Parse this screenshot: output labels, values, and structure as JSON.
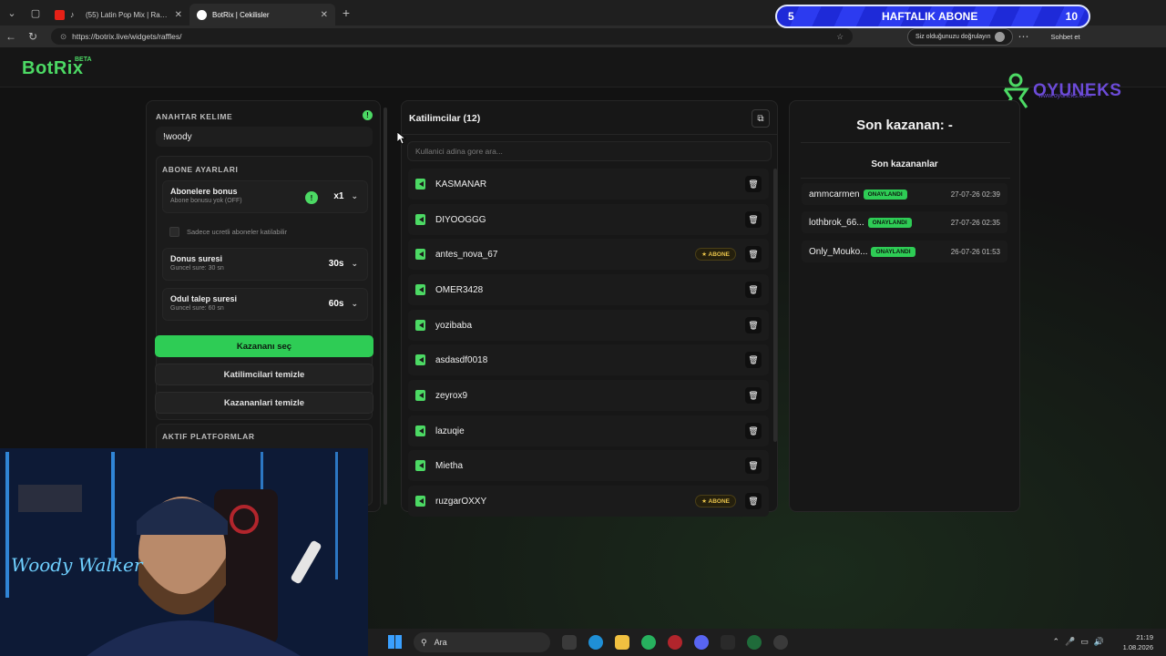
{
  "browser": {
    "tabs": [
      {
        "title": "(55) Latin Pop Mix | Radio Hit..."
      },
      {
        "title": "BotRix | Cekilisler"
      }
    ],
    "url": "https://botrix.live/widgets/raffles/",
    "verify_label": "Siz olduğunuzu doğrulayın",
    "chat_label": "Sohbet et"
  },
  "goal_bar": {
    "current": "5",
    "label": "HAFTALIK ABONE",
    "target": "10"
  },
  "app": {
    "logo": "BotRix",
    "beta": "BETA",
    "brand_name": "OYUNEKS",
    "brand_url": "www.oyuneks.com"
  },
  "settings": {
    "keyword_label": "ANAHTAR KELIME",
    "keyword_value": "!woody",
    "sub_settings_label": "ABONE AYARLARI",
    "sub_bonus_title": "Abonelere bonus",
    "sub_bonus_sub": "Abone bonusu yok (OFF)",
    "sub_bonus_value": "x1",
    "paid_only_label": "Sadece ucretli aboneler katilabilir",
    "bonus_time_title": "Donus suresi",
    "bonus_time_sub": "Guncel sure: 30 sn",
    "bonus_time_value": "30s",
    "claim_time_title": "Odul talep suresi",
    "claim_time_sub": "Guncel sure: 60 sn",
    "claim_time_value": "60s",
    "pick_winner": "Kazananı seç",
    "clear_participants": "Katilimcilari temizle",
    "clear_winners": "Kazananlari temizle",
    "platforms_label": "AKTIF PLATFORMLAR"
  },
  "participants": {
    "title": "Katilimcilar (12)",
    "search_placeholder": "Kullanici adina gore ara...",
    "list": [
      {
        "name": "KASMANAR",
        "badge": ""
      },
      {
        "name": "DIYOOGGG",
        "badge": ""
      },
      {
        "name": "antes_nova_67",
        "badge": "ABONE"
      },
      {
        "name": "OMER3428",
        "badge": ""
      },
      {
        "name": "yozibaba",
        "badge": ""
      },
      {
        "name": "asdasdf0018",
        "badge": ""
      },
      {
        "name": "zeyrox9",
        "badge": ""
      },
      {
        "name": "lazuqie",
        "badge": ""
      },
      {
        "name": "Mietha",
        "badge": ""
      },
      {
        "name": "ruzgarOXXY",
        "badge": "ABONE"
      }
    ]
  },
  "winners": {
    "last_winner": "Son kazanan: -",
    "recent_title": "Son kazananlar",
    "list": [
      {
        "name": "ammcarmen",
        "status": "ONAYLANDI",
        "date": "27-07-26 02:39"
      },
      {
        "name": "lothbrok_66...",
        "status": "ONAYLANDI",
        "date": "27-07-26 02:35"
      },
      {
        "name": "Only_Mouko...",
        "status": "ONAYLANDI",
        "date": "26-07-26 01:53"
      }
    ]
  },
  "taskbar": {
    "search": "Ara",
    "time": "21:19",
    "date": "1.08.2026"
  },
  "colors": {
    "accent": "#2ecc55",
    "kick_green": "#4cd964",
    "goal_blue": "#1e2ad8",
    "brand_purple": "#6c4bd8"
  }
}
